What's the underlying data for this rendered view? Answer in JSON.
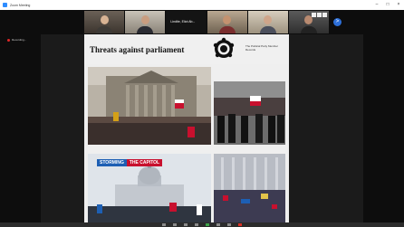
{
  "window": {
    "title": "Zoom Meeting"
  },
  "gallery": {
    "tiles": [
      {
        "name": ""
      },
      {
        "name": ""
      },
      {
        "name": "Lindtie, Eliot Ab..."
      },
      {
        "name": ""
      },
      {
        "name": ""
      },
      {
        "name": ""
      }
    ],
    "next_label": ">"
  },
  "recording": {
    "label": "Recording..."
  },
  "slide": {
    "title": "Threats against parliament",
    "source": "The Political Party Member Records",
    "banner_left": "STORMING",
    "banner_right": "THE CAPITOL"
  },
  "colors": {
    "accent": "#2d8cff",
    "record": "#e02828",
    "leave": "#d93025"
  }
}
